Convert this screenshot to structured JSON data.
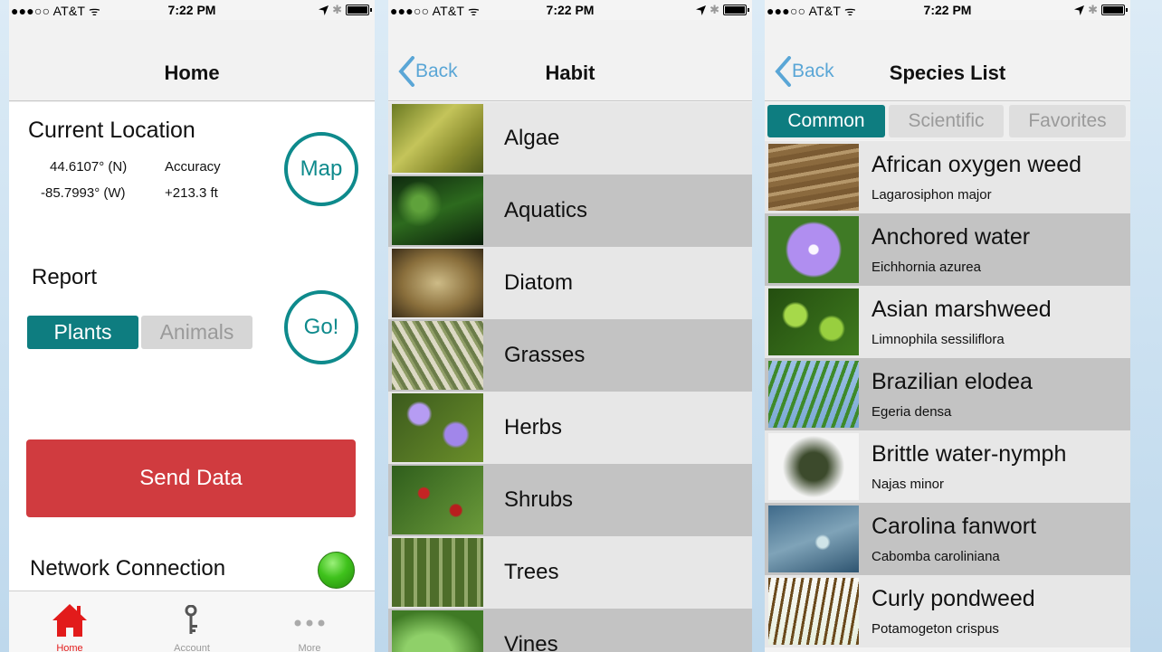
{
  "status_bar": {
    "carrier": "●●●○○ AT&T ᯤ",
    "time": "7:22 PM",
    "icons": [
      "location-arrow-icon",
      "bluetooth-icon",
      "battery-icon"
    ]
  },
  "home": {
    "title": "Home",
    "current_location": {
      "title": "Current Location",
      "latitude": "44.6107° (N)",
      "longitude": "-85.7993° (W)",
      "accuracy_label": "Accuracy",
      "accuracy_value": "+213.3 ft",
      "map_button": "Map"
    },
    "report": {
      "title": "Report",
      "segments": [
        {
          "label": "Plants",
          "selected": true
        },
        {
          "label": "Animals",
          "selected": false
        }
      ],
      "go_button": "Go!"
    },
    "send_button": "Send Data",
    "network_label": "Network Connection",
    "network_status_color": "#3fc21c",
    "tabs": [
      {
        "label": "Home",
        "icon": "home-icon",
        "active": true
      },
      {
        "label": "Account",
        "icon": "key-icon",
        "active": false
      },
      {
        "label": "More",
        "icon": "more-dots-icon",
        "active": false
      }
    ]
  },
  "habit": {
    "back_label": "Back",
    "title": "Habit",
    "items": [
      {
        "label": "Algae",
        "thumb": "algae"
      },
      {
        "label": "Aquatics",
        "thumb": "aquatics"
      },
      {
        "label": "Diatom",
        "thumb": "diatom"
      },
      {
        "label": "Grasses",
        "thumb": "grasses"
      },
      {
        "label": "Herbs",
        "thumb": "herbs"
      },
      {
        "label": "Shrubs",
        "thumb": "shrubs"
      },
      {
        "label": "Trees",
        "thumb": "trees"
      },
      {
        "label": "Vines",
        "thumb": "vines"
      }
    ]
  },
  "species": {
    "back_label": "Back",
    "title": "Species List",
    "segments": [
      {
        "label": "Common",
        "selected": true
      },
      {
        "label": "Scientific",
        "selected": false
      },
      {
        "label": "Favorites",
        "selected": false
      }
    ],
    "items": [
      {
        "common": "African oxygen weed",
        "scientific": "Lagarosiphon major",
        "thumb": "oxygen"
      },
      {
        "common": "Anchored water",
        "scientific": "Eichhornia azurea",
        "thumb": "anchored"
      },
      {
        "common": "Asian marshweed",
        "scientific": "Limnophila sessiliflora",
        "thumb": "asian"
      },
      {
        "common": "Brazilian elodea",
        "scientific": "Egeria densa",
        "thumb": "brazil"
      },
      {
        "common": "Brittle water-nymph",
        "scientific": "Najas minor",
        "thumb": "brittle"
      },
      {
        "common": "Carolina fanwort",
        "scientific": "Cabomba caroliniana",
        "thumb": "carolina"
      },
      {
        "common": "Curly pondweed",
        "scientific": "Potamogeton crispus",
        "thumb": "curly"
      }
    ]
  },
  "colors": {
    "accent_teal": "#0e7d80",
    "send_red": "#d03b3f",
    "back_blue": "#5aa6d6",
    "home_active_red": "#e21b1b"
  }
}
